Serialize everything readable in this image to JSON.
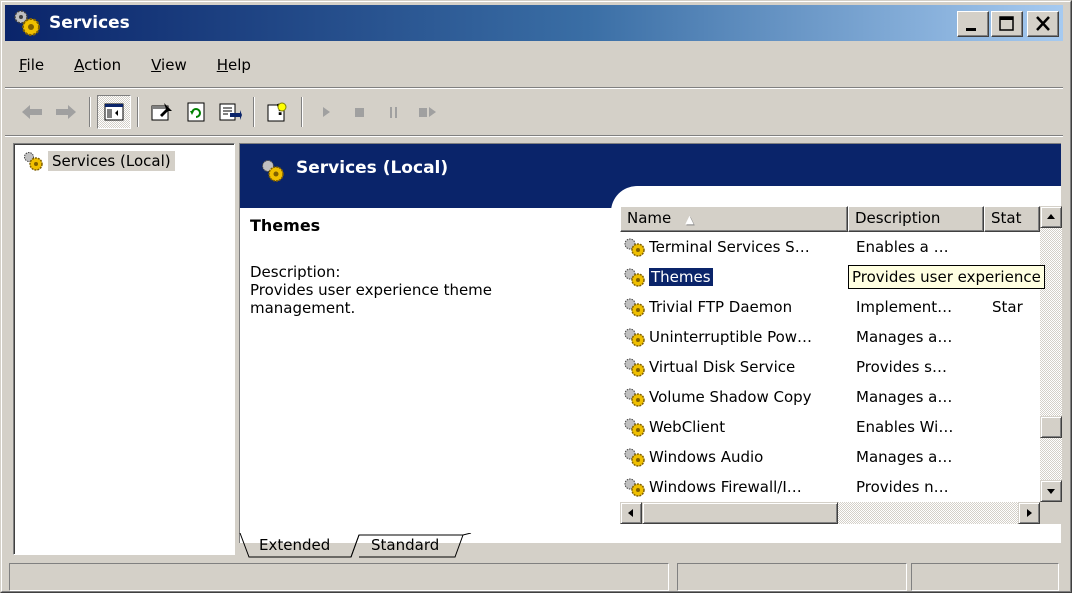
{
  "window": {
    "title": "Services",
    "icon": "services-gears-icon",
    "caption_buttons": [
      "minimize-icon",
      "maximize-icon",
      "close-icon"
    ]
  },
  "menu": {
    "items": [
      {
        "label": "File",
        "accel": "F",
        "rest": "ile"
      },
      {
        "label": "Action",
        "accel": "A",
        "rest": "ction"
      },
      {
        "label": "View",
        "accel": "V",
        "rest": "iew"
      },
      {
        "label": "Help",
        "accel": "H",
        "rest": "elp"
      }
    ]
  },
  "toolbar": {
    "buttons": [
      "back-arrow-icon",
      "forward-arrow-icon",
      "show-hide-console-tree-icon",
      "properties-icon",
      "refresh-icon",
      "export-list-icon",
      "help-icon",
      "start-service-icon",
      "stop-service-icon",
      "pause-service-icon",
      "restart-service-icon"
    ],
    "pressed": "show-hide-console-tree-icon"
  },
  "tree": {
    "root_label": "Services (Local)"
  },
  "banner": {
    "title": "Services (Local)"
  },
  "detail": {
    "service_name": "Themes",
    "description_label": "Description:",
    "description_line1": "Provides user experience theme",
    "description_line2": "management."
  },
  "list": {
    "columns": [
      {
        "label": "Name",
        "sorted": "ascending"
      },
      {
        "label": "Description"
      },
      {
        "label": "Stat"
      }
    ],
    "rows": [
      {
        "name": "Terminal Services S…",
        "description": "Enables a …",
        "status": ""
      },
      {
        "name": "Themes",
        "description": "Provides user experience",
        "status": "",
        "selected": true
      },
      {
        "name": "Trivial FTP Daemon",
        "description": "Implement…",
        "status": "Star"
      },
      {
        "name": "Uninterruptible Pow…",
        "description": "Manages a…",
        "status": ""
      },
      {
        "name": "Virtual Disk Service",
        "description": "Provides s…",
        "status": ""
      },
      {
        "name": "Volume Shadow Copy",
        "description": "Manages a…",
        "status": ""
      },
      {
        "name": "WebClient",
        "description": "Enables Wi…",
        "status": ""
      },
      {
        "name": "Windows Audio",
        "description": "Manages a…",
        "status": ""
      },
      {
        "name": "Windows Firewall/I…",
        "description": "Provides n…",
        "status": ""
      }
    ]
  },
  "tabs": {
    "items": [
      {
        "label": "Extended",
        "active": true
      },
      {
        "label": "Standard",
        "active": false
      }
    ]
  },
  "status_bar": {
    "panels": [
      "",
      "",
      ""
    ]
  },
  "colors": {
    "title_gradient_start": "#0a246a",
    "title_gradient_end": "#a6caf0",
    "banner": "#0a246a",
    "selection": "#0a246a",
    "face": "#d4d0c8",
    "tooltip": "#ffffe1"
  }
}
